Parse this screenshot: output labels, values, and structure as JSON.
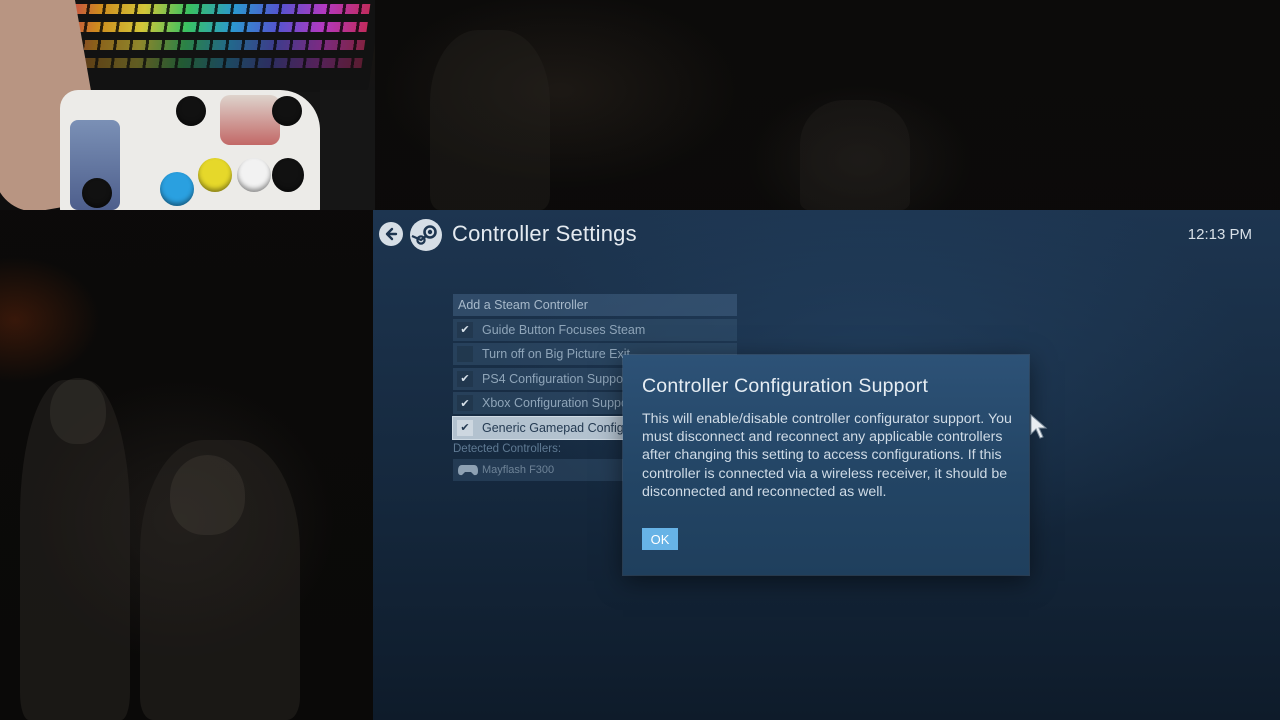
{
  "header": {
    "title": "Controller Settings",
    "clock": "12:13 PM"
  },
  "settings": {
    "add_controller": "Add a Steam Controller",
    "items": [
      {
        "label": "Guide Button Focuses Steam",
        "checked": true
      },
      {
        "label": "Turn off on Big Picture Exit",
        "checked": false
      },
      {
        "label": "PS4 Configuration Support",
        "checked": true
      },
      {
        "label": "Xbox Configuration Support",
        "checked": true
      },
      {
        "label": "Generic Gamepad Configuration Support",
        "checked": true,
        "selected": true
      }
    ],
    "detected_label": "Detected Controllers:",
    "detected_devices": [
      "Mayflash F300"
    ]
  },
  "dialog": {
    "title": "Controller Configuration Support",
    "body": "This will enable/disable controller configurator support.  You must disconnect and reconnect any applicable controllers after changing this setting to access configurations.  If this controller is connected via a wireless receiver, it should be disconnected and reconnected as well.",
    "ok_label": "OK"
  },
  "colors": {
    "accent": "#67b3e6",
    "panel": "#234565",
    "background": "#15283d"
  },
  "icons": [
    "back-arrow-icon",
    "steam-logo-icon",
    "checkmark-icon",
    "gamepad-icon",
    "mouse-cursor-icon"
  ]
}
